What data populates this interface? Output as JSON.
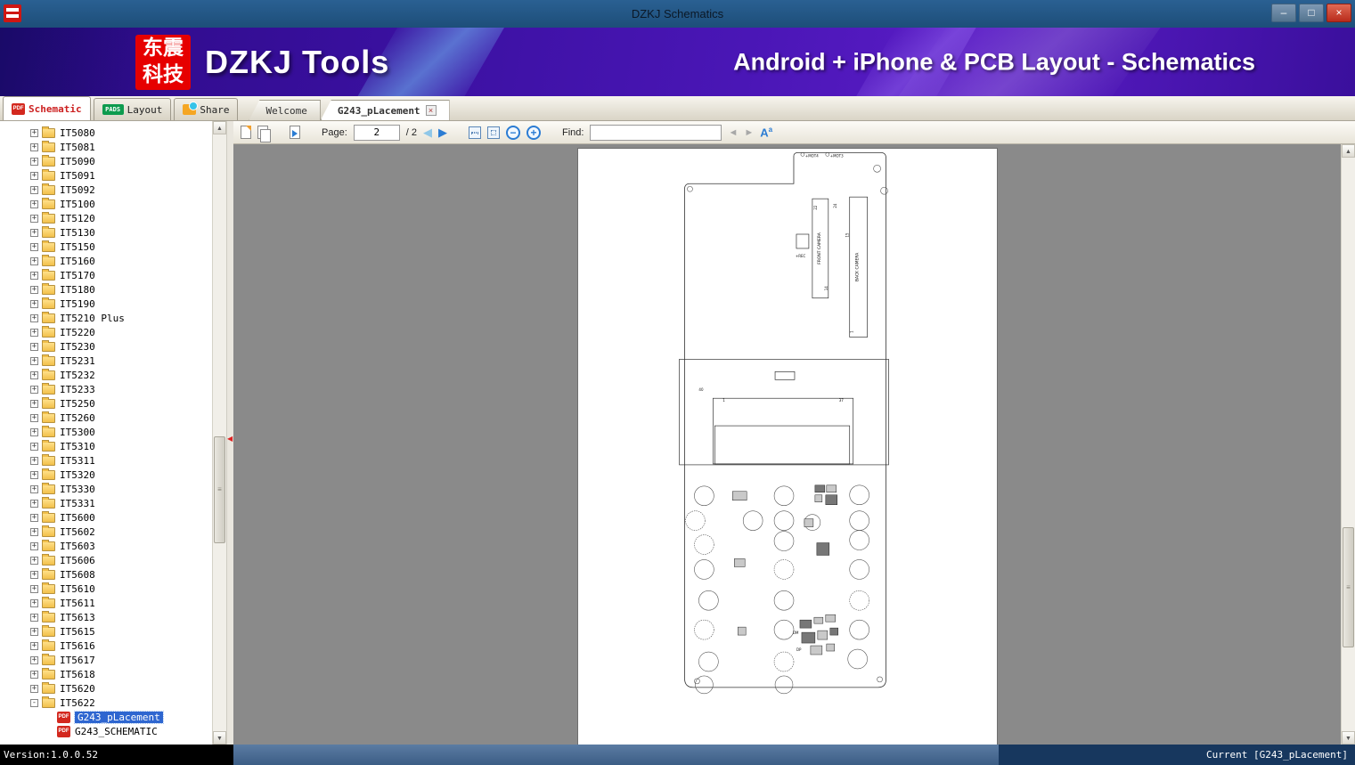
{
  "window": {
    "title": "DZKJ Schematics",
    "minimize": "–",
    "maximize": "□",
    "close": "×"
  },
  "banner": {
    "logo_cn_top": "东震",
    "logo_cn_bottom": "科技",
    "product": "DZKJ Tools",
    "tagline": "Android + iPhone & PCB Layout - Schematics"
  },
  "icons": {
    "pdf": "PDF",
    "pads": "PADS",
    "close_tab": "×",
    "prev": "◀",
    "next": "▶",
    "zoom_out": "−",
    "zoom_in": "+",
    "find_prev": "◄",
    "find_next": "►",
    "font_big": "A",
    "font_small": "a",
    "scroll_up": "▲",
    "scroll_down": "▼",
    "grip": "≡",
    "collapse": "◀"
  },
  "ribbon_tabs": [
    {
      "label": "Schematic"
    },
    {
      "label": "Layout"
    },
    {
      "label": "Share"
    }
  ],
  "doc_tabs": [
    {
      "label": "Welcome"
    },
    {
      "label": "G243_pLacement"
    }
  ],
  "toolbar": {
    "page_label": "Page:",
    "page_value": "2",
    "page_total": "/ 2",
    "find_label": "Find:",
    "find_value": ""
  },
  "sidebar": {
    "folders": [
      {
        "label": "IT5080",
        "toggle": "+"
      },
      {
        "label": "IT5081",
        "toggle": "+"
      },
      {
        "label": "IT5090",
        "toggle": "+"
      },
      {
        "label": "IT5091",
        "toggle": "+"
      },
      {
        "label": "IT5092",
        "toggle": "+"
      },
      {
        "label": "IT5100",
        "toggle": "+"
      },
      {
        "label": "IT5120",
        "toggle": "+"
      },
      {
        "label": "IT5130",
        "toggle": "+"
      },
      {
        "label": "IT5150",
        "toggle": "+"
      },
      {
        "label": "IT5160",
        "toggle": "+"
      },
      {
        "label": "IT5170",
        "toggle": "+"
      },
      {
        "label": "IT5180",
        "toggle": "+"
      },
      {
        "label": "IT5190",
        "toggle": "+"
      },
      {
        "label": "IT5210 Plus",
        "toggle": "+"
      },
      {
        "label": "IT5220",
        "toggle": "+"
      },
      {
        "label": "IT5230",
        "toggle": "+"
      },
      {
        "label": "IT5231",
        "toggle": "+"
      },
      {
        "label": "IT5232",
        "toggle": "+"
      },
      {
        "label": "IT5233",
        "toggle": "+"
      },
      {
        "label": "IT5250",
        "toggle": "+"
      },
      {
        "label": "IT5260",
        "toggle": "+"
      },
      {
        "label": "IT5300",
        "toggle": "+"
      },
      {
        "label": "IT5310",
        "toggle": "+"
      },
      {
        "label": "IT5311",
        "toggle": "+"
      },
      {
        "label": "IT5320",
        "toggle": "+"
      },
      {
        "label": "IT5330",
        "toggle": "+"
      },
      {
        "label": "IT5331",
        "toggle": "+"
      },
      {
        "label": "IT5600",
        "toggle": "+"
      },
      {
        "label": "IT5602",
        "toggle": "+"
      },
      {
        "label": "IT5603",
        "toggle": "+"
      },
      {
        "label": "IT5606",
        "toggle": "+"
      },
      {
        "label": "IT5608",
        "toggle": "+"
      },
      {
        "label": "IT5610",
        "toggle": "+"
      },
      {
        "label": "IT5611",
        "toggle": "+"
      },
      {
        "label": "IT5613",
        "toggle": "+"
      },
      {
        "label": "IT5615",
        "toggle": "+"
      },
      {
        "label": "IT5616",
        "toggle": "+"
      },
      {
        "label": "IT5617",
        "toggle": "+"
      },
      {
        "label": "IT5618",
        "toggle": "+"
      },
      {
        "label": "IT5620",
        "toggle": "+"
      },
      {
        "label": "IT5622",
        "toggle": "-",
        "cls": "expanded"
      }
    ],
    "files": [
      {
        "label": "G243_pLacement",
        "selected": true
      },
      {
        "label": "G243_SCHEMATIC",
        "selected": false
      }
    ]
  },
  "schematic": {
    "labels": [
      "+MOT4",
      "+MOT3",
      "FRONT CAMERA",
      "BACK CAMERA",
      "+REC",
      "22",
      "24",
      "15",
      "14",
      "1",
      "40",
      "1",
      "37",
      "DM",
      "DP"
    ]
  },
  "statusbar": {
    "version": "Version:1.0.0.52",
    "current": "Current [G243_pLacement]"
  }
}
